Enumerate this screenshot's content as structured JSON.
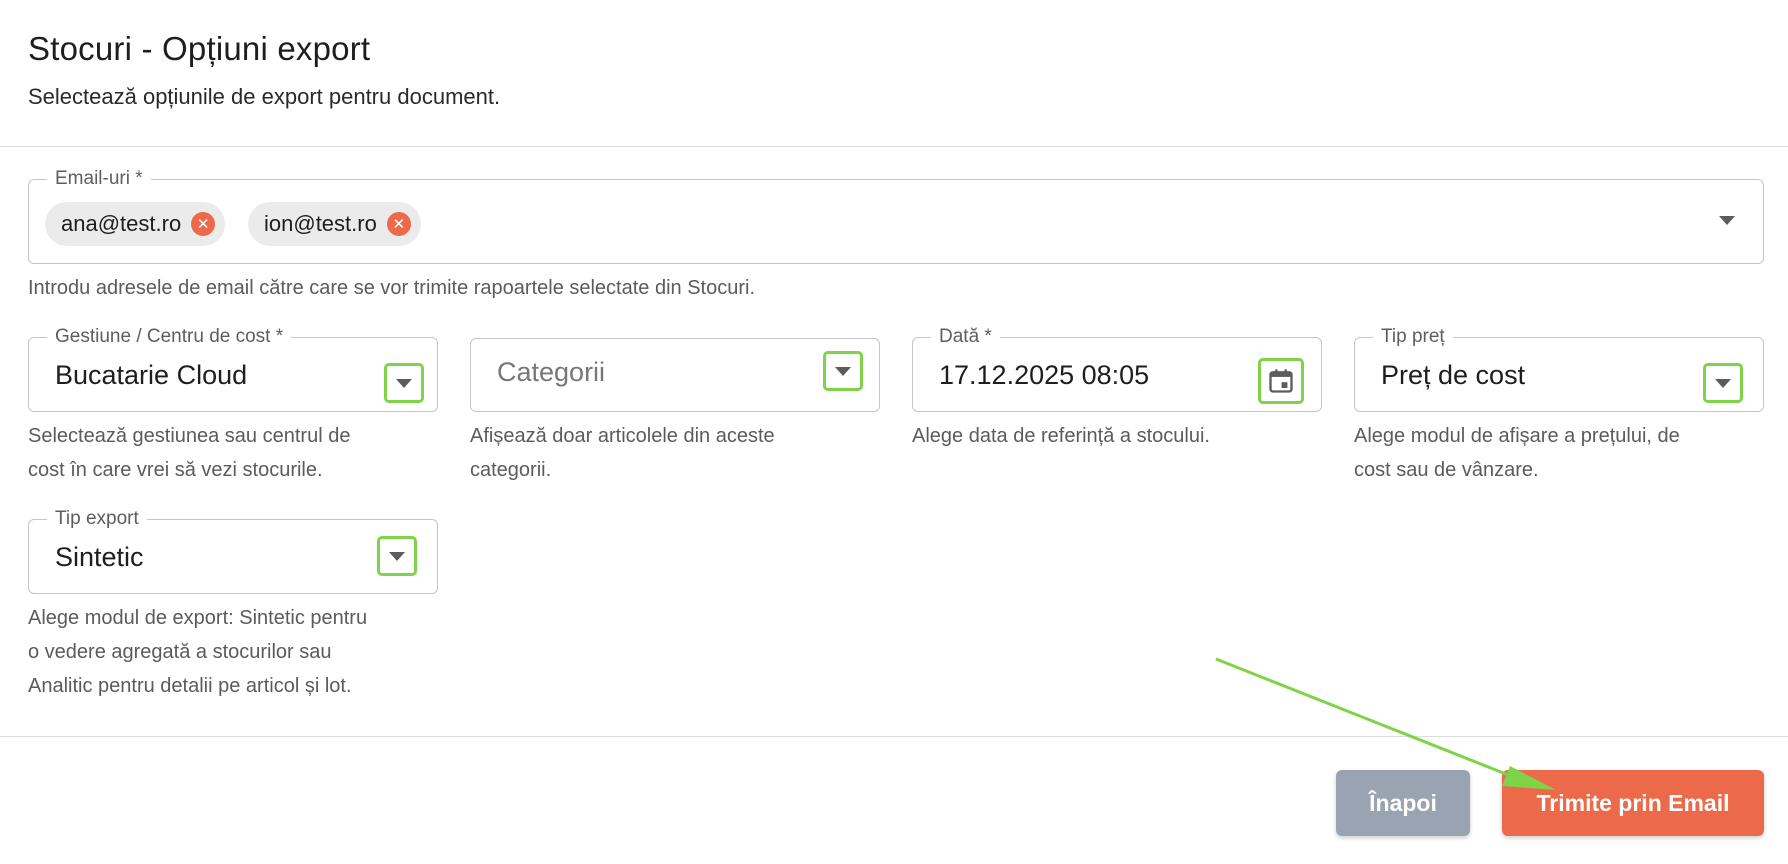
{
  "header": {
    "title": "Stocuri - Opțiuni export",
    "subtitle": "Selectează opțiunile de export pentru document."
  },
  "emails": {
    "label": "Email-uri *",
    "chips": [
      "ana@test.ro",
      "ion@test.ro"
    ],
    "chip_remove_icon": "close-circle-icon",
    "dropdown_icon": "caret-down-icon",
    "helper": "Introdu adresele de email către care se vor trimite rapoartele selectate din Stocuri."
  },
  "gestiune": {
    "label": "Gestiune / Centru de cost *",
    "value": "Bucatarie Cloud",
    "helper_lines": [
      "Selectează gestiunea sau centrul de",
      "cost în care vrei să vezi stocurile."
    ]
  },
  "categorii": {
    "placeholder": "Categorii",
    "helper_lines": [
      "Afișează doar articolele din aceste",
      "categorii."
    ]
  },
  "data": {
    "label": "Dată *",
    "value": "17.12.2025 08:05",
    "icon": "calendar-icon",
    "helper_lines": [
      "Alege data de referință a stocului."
    ]
  },
  "tip_pret": {
    "label": "Tip preț",
    "value": "Preț de cost",
    "helper_lines": [
      "Alege modul de afișare a prețului, de",
      "cost sau de vânzare."
    ]
  },
  "tip_export": {
    "label": "Tip export",
    "value": "Sintetic",
    "helper_lines": [
      "Alege modul de export: Sintetic pentru",
      "o vedere agregată a stocurilor sau",
      "Analitic pentru detalii pe articol și lot."
    ]
  },
  "buttons": {
    "back": "Înapoi",
    "send": "Trimite prin Email"
  },
  "colors": {
    "accent": "#ec6a49",
    "highlight": "#7ed348",
    "secondary_button": "#99a3b2"
  }
}
